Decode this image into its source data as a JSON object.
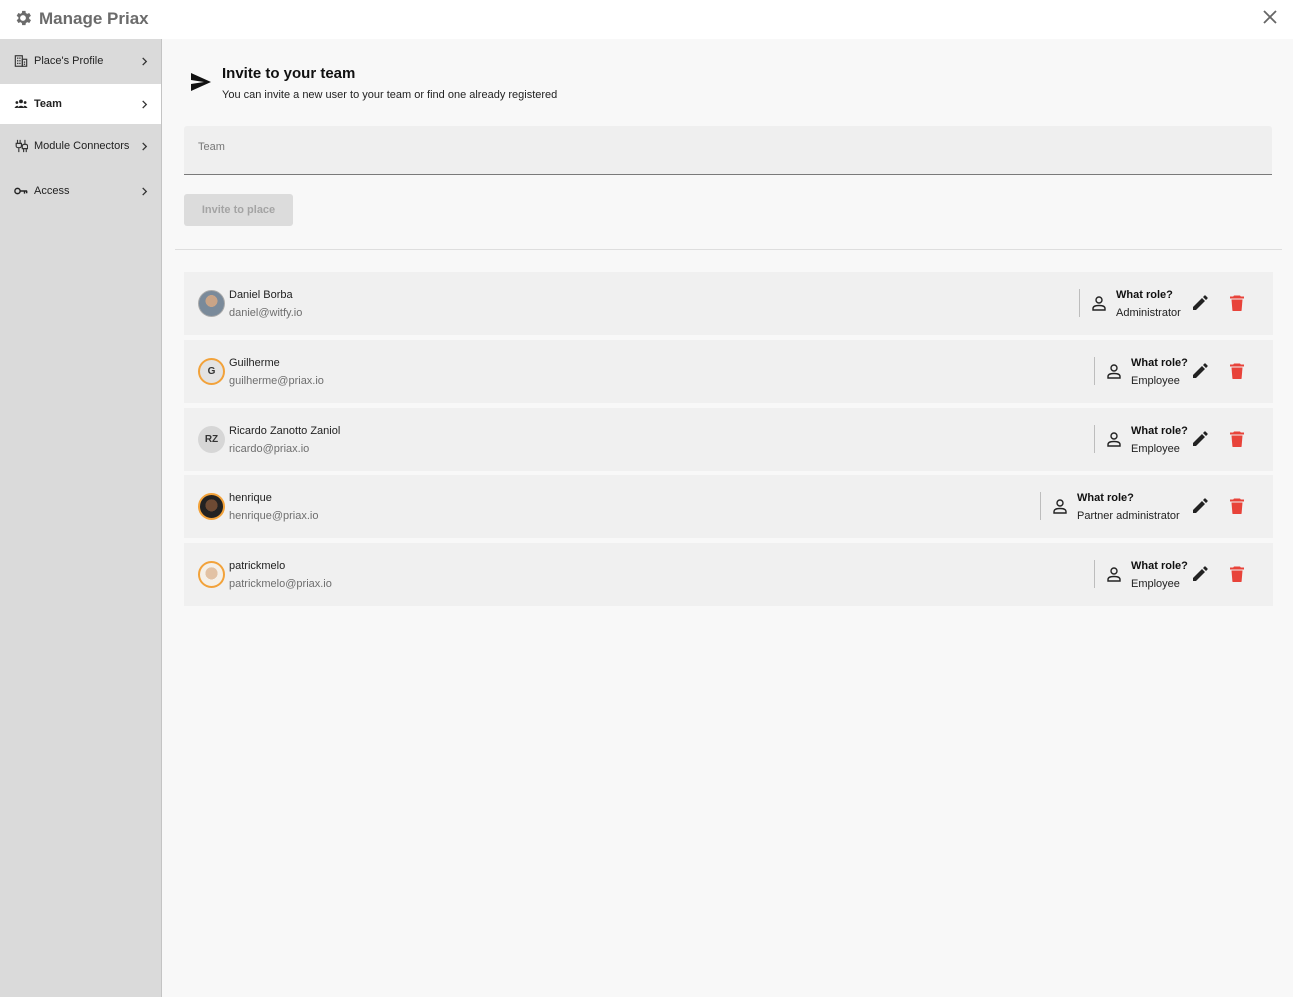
{
  "header": {
    "title": "Manage Priax"
  },
  "sidebar": {
    "items": [
      {
        "label": "Place's Profile",
        "icon": "building-icon"
      },
      {
        "label": "Team",
        "icon": "people-icon"
      },
      {
        "label": "Module Connectors",
        "icon": "connector-icon"
      },
      {
        "label": "Access",
        "icon": "key-icon"
      }
    ],
    "active": "Team"
  },
  "invite": {
    "title": "Invite to your team",
    "subtitle": "You can invite a new user to your team or find one already registered",
    "field_label": "Team",
    "button_label": "Invite to place"
  },
  "members": [
    {
      "name": "Daniel Borba",
      "email": "daniel@witfy.io",
      "avatar": "photo",
      "role_prompt": "What role?",
      "role": "Administrator"
    },
    {
      "name": "Guilherme",
      "email": "guilherme@priax.io",
      "avatar": "G",
      "role_prompt": "What role?",
      "role": "Employee"
    },
    {
      "name": "Ricardo Zanotto Zaniol",
      "email": "ricardo@priax.io",
      "avatar": "RZ",
      "role_prompt": "What role?",
      "role": "Employee"
    },
    {
      "name": "henrique",
      "email": "henrique@priax.io",
      "avatar": "photo",
      "role_prompt": "What role?",
      "role": "Partner administrator"
    },
    {
      "name": "patrickmelo",
      "email": "patrickmelo@priax.io",
      "avatar": "photo",
      "role_prompt": "What role?",
      "role": "Employee"
    }
  ],
  "colors": {
    "sidebar_bg": "#dadada",
    "main_bg": "#f8f8f8",
    "row_bg": "#f0f0f0",
    "delete": "#e8433a",
    "avatar_ring": "#f2a23a"
  }
}
